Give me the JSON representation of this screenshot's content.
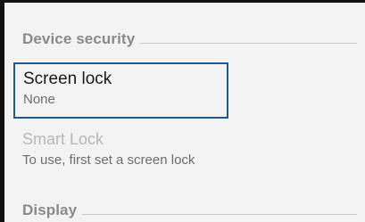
{
  "sections": [
    {
      "title": "Device security",
      "items": [
        {
          "title": "Screen lock",
          "summary": "None",
          "state": "focused"
        },
        {
          "title": "Smart Lock",
          "summary": "To use, first set a screen lock",
          "state": "disabled"
        }
      ]
    },
    {
      "title": "Display",
      "items": []
    }
  ],
  "colors": {
    "background": "#f3f3f3",
    "focus_border": "#1b5a8e",
    "section_title": "#8a8a8a",
    "disabled_title": "#b8b8b8"
  }
}
